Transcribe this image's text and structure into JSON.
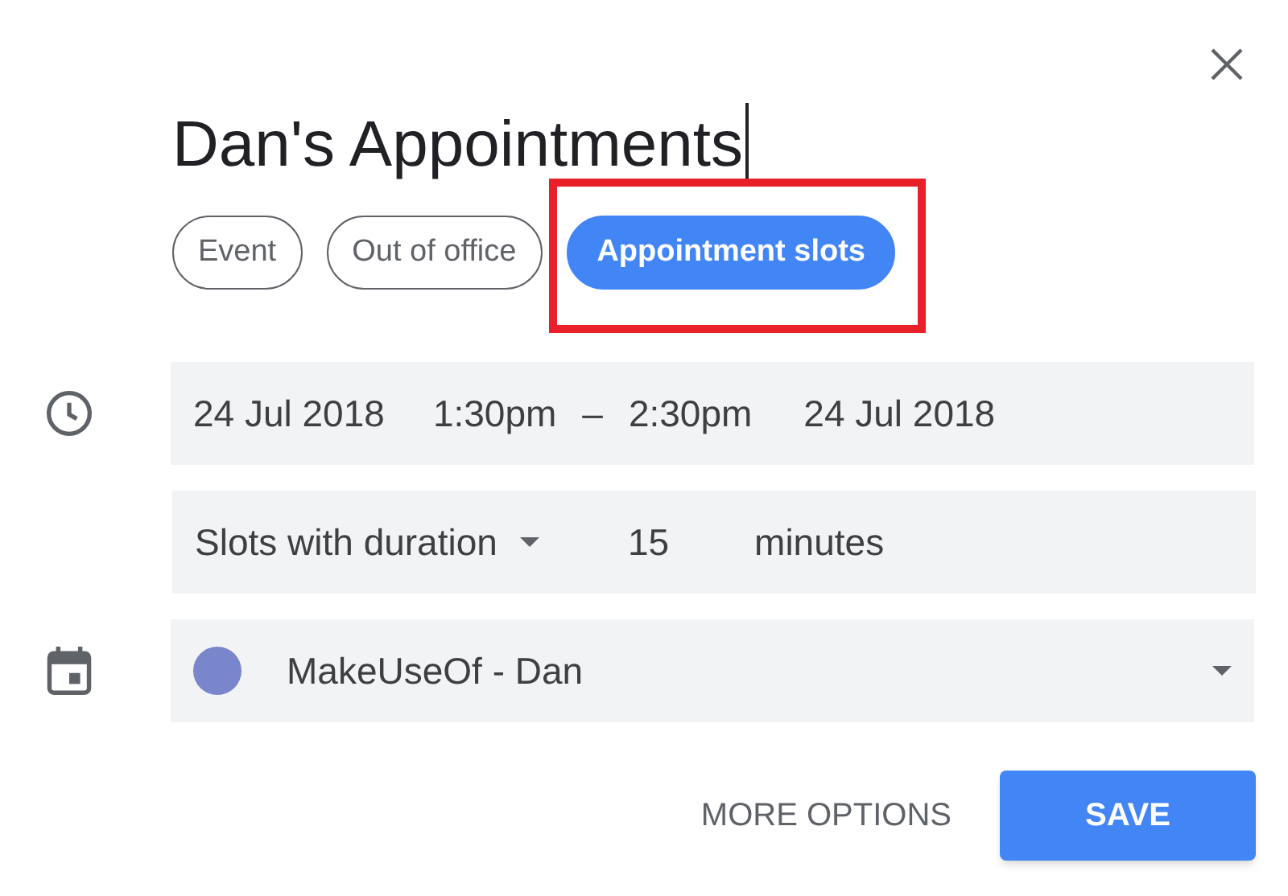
{
  "title": "Dan's Appointments",
  "chips": [
    {
      "label": "Event",
      "selected": false,
      "highlighted": false
    },
    {
      "label": "Out of office",
      "selected": false,
      "highlighted": false
    },
    {
      "label": "Appointment slots",
      "selected": true,
      "highlighted": true
    }
  ],
  "time": {
    "start_date": "24 Jul 2018",
    "start_time": "1:30pm",
    "separator": "–",
    "end_time": "2:30pm",
    "end_date": "24 Jul 2018"
  },
  "slots": {
    "mode": "Slots with duration",
    "duration": "15",
    "unit": "minutes"
  },
  "calendar": {
    "name": "MakeUseOf - Dan",
    "color": "#7986cb"
  },
  "buttons": {
    "more": "MORE OPTIONS",
    "save": "SAVE"
  }
}
